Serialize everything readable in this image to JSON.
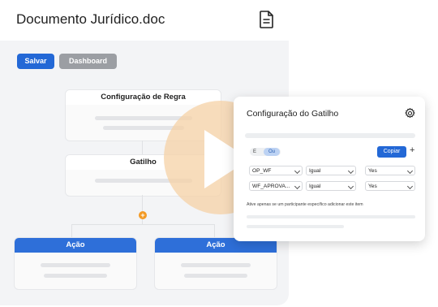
{
  "document": {
    "title": "Documento Jurídico.doc",
    "icon": "document-icon"
  },
  "toolbar": {
    "save_label": "Salvar",
    "dashboard_label": "Dashboard"
  },
  "workflow": {
    "rule_node_title": "Configuração de Regra",
    "trigger_node_title": "Gatilho",
    "action_left_title": "Ação",
    "action_right_title": "Ação"
  },
  "video_overlay": {
    "icon": "play-icon",
    "color": "#f6d2a6"
  },
  "trigger_panel": {
    "title": "Configuração do Gatilho",
    "settings_icon": "gear-icon",
    "logic_and": "E",
    "logic_or": "Ou",
    "copy_label": "Copiar",
    "add_label": "+",
    "conditions": [
      {
        "field": "OP_WF",
        "operator": "Igual",
        "value": "Yes"
      },
      {
        "field": "WF_APROVA...",
        "operator": "Igual",
        "value": "Yes"
      }
    ],
    "hint": "Ative apenas se um participante específico adicionar este item"
  },
  "colors": {
    "primary": "#2368d6",
    "accent": "#f39a25",
    "muted_button": "#9b9ea3"
  }
}
